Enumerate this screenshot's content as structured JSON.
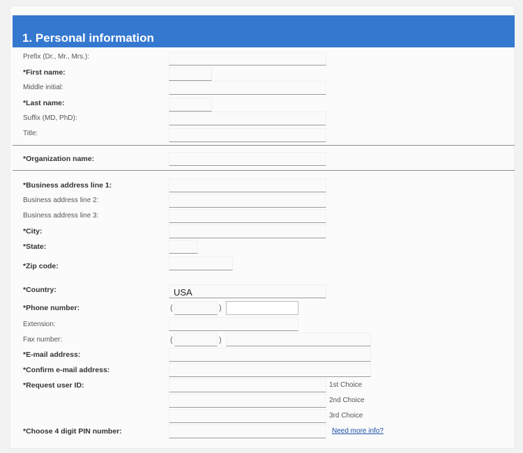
{
  "section": {
    "title": "1. Personal information"
  },
  "labels": {
    "prefix": "Prefix (Dr., Mr., Mrs.):",
    "first_name": "*First name:",
    "middle_initial": "Middle initial:",
    "last_name": "*Last name:",
    "suffix": "Suffix (MD, PhD):",
    "title": "Title:",
    "organization": "*Organization name:",
    "address1": "*Business address line 1:",
    "address2": "Business address line 2:",
    "address3": "Business address line 3:",
    "city": "*City:",
    "state": "*State:",
    "zip": "*Zip code:",
    "country": "*Country:",
    "phone": "*Phone number:",
    "extension": "Extension:",
    "fax": "Fax number:",
    "email": "*E-mail address:",
    "confirm_email": "*Confirm e-mail address:",
    "user_id": "*Request user ID:",
    "pin": "*Choose 4 digit PIN number:"
  },
  "values": {
    "country": "USA"
  },
  "phone_parens": {
    "open": "(",
    "close": ")"
  },
  "user_id_choices": [
    "1st Choice",
    "2nd Choice",
    "3rd Choice"
  ],
  "help_link": "Need more info?"
}
